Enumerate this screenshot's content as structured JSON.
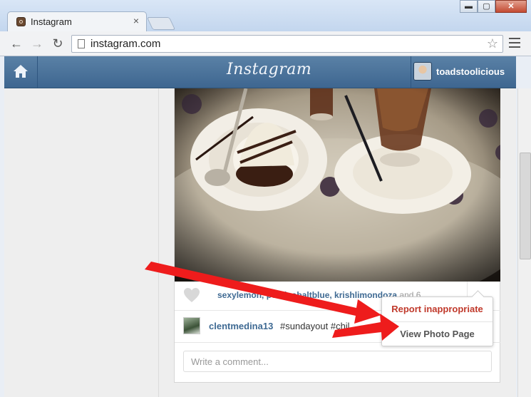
{
  "browser": {
    "tab_title": "Instagram",
    "tab_close": "×",
    "url": "instagram.com",
    "back": "←",
    "forward": "→",
    "reload": "↻",
    "star": "☆",
    "window_controls": {
      "minimize": "▬",
      "maximize": "▢",
      "close": "✕"
    }
  },
  "header": {
    "logo": "Instagram",
    "username": "toadstoolicious"
  },
  "post": {
    "likers": "sexylemon, pearlcobaltblue, krishlimondoza",
    "likers_more": " and 6",
    "comment": {
      "user": "clentmedina13",
      "text": "#sundayout #chil"
    },
    "comment_placeholder": "Write a comment..."
  },
  "menu": {
    "report": "Report inappropriate",
    "view": "View Photo Page"
  },
  "colors": {
    "header_blue": "#3e6690",
    "link_blue": "#3f6a93",
    "report_red": "#c0392b",
    "arrow_red": "#ee1c1c"
  }
}
